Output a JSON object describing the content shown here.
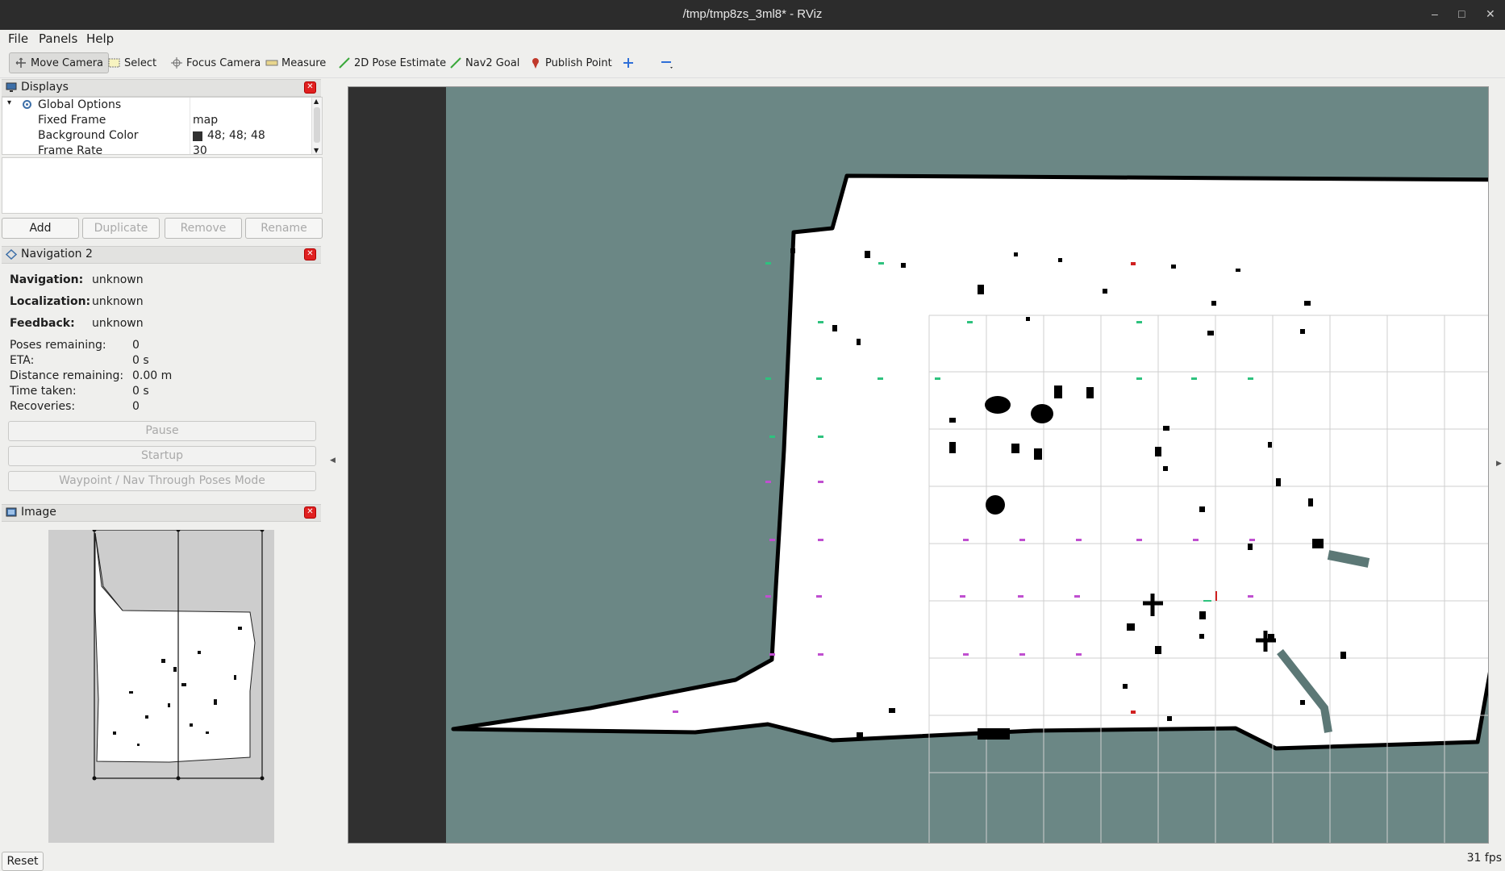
{
  "window": {
    "title": "/tmp/tmp8zs_3ml8* - RViz"
  },
  "menu": [
    "File",
    "Panels",
    "Help"
  ],
  "toolbar": {
    "move_camera": "Move Camera",
    "select": "Select",
    "focus_camera": "Focus Camera",
    "measure": "Measure",
    "pose_estimate": "2D Pose Estimate",
    "nav2_goal": "Nav2 Goal",
    "publish_point": "Publish Point"
  },
  "displays": {
    "title": "Displays",
    "global_options": "Global Options",
    "rows": [
      {
        "name": "Fixed Frame",
        "value": "map"
      },
      {
        "name": "Background Color",
        "value": "48; 48; 48"
      },
      {
        "name": "Frame Rate",
        "value": "30"
      }
    ],
    "buttons": {
      "add": "Add",
      "duplicate": "Duplicate",
      "remove": "Remove",
      "rename": "Rename"
    }
  },
  "navigation": {
    "title": "Navigation 2",
    "navigation_label": "Navigation:",
    "navigation_value": "unknown",
    "localization_label": "Localization:",
    "localization_value": "unknown",
    "feedback_label": "Feedback:",
    "feedback_value": "unknown",
    "poses_label": "Poses remaining:",
    "poses_value": "0",
    "eta_label": "ETA:",
    "eta_value": "0 s",
    "distance_label": "Distance remaining:",
    "distance_value": "0.00 m",
    "time_label": "Time taken:",
    "time_value": "0 s",
    "recoveries_label": "Recoveries:",
    "recoveries_value": "0",
    "pause": "Pause",
    "startup": "Startup",
    "waypoint_mode": "Waypoint / Nav Through Poses Mode"
  },
  "image_panel": {
    "title": "Image"
  },
  "status": {
    "reset": "Reset",
    "fps": "31 fps"
  },
  "colors": {
    "map_background": "#6b8785",
    "free_space": "#ffffff",
    "obstacle": "#000000",
    "viewport_bg": "#303030"
  }
}
